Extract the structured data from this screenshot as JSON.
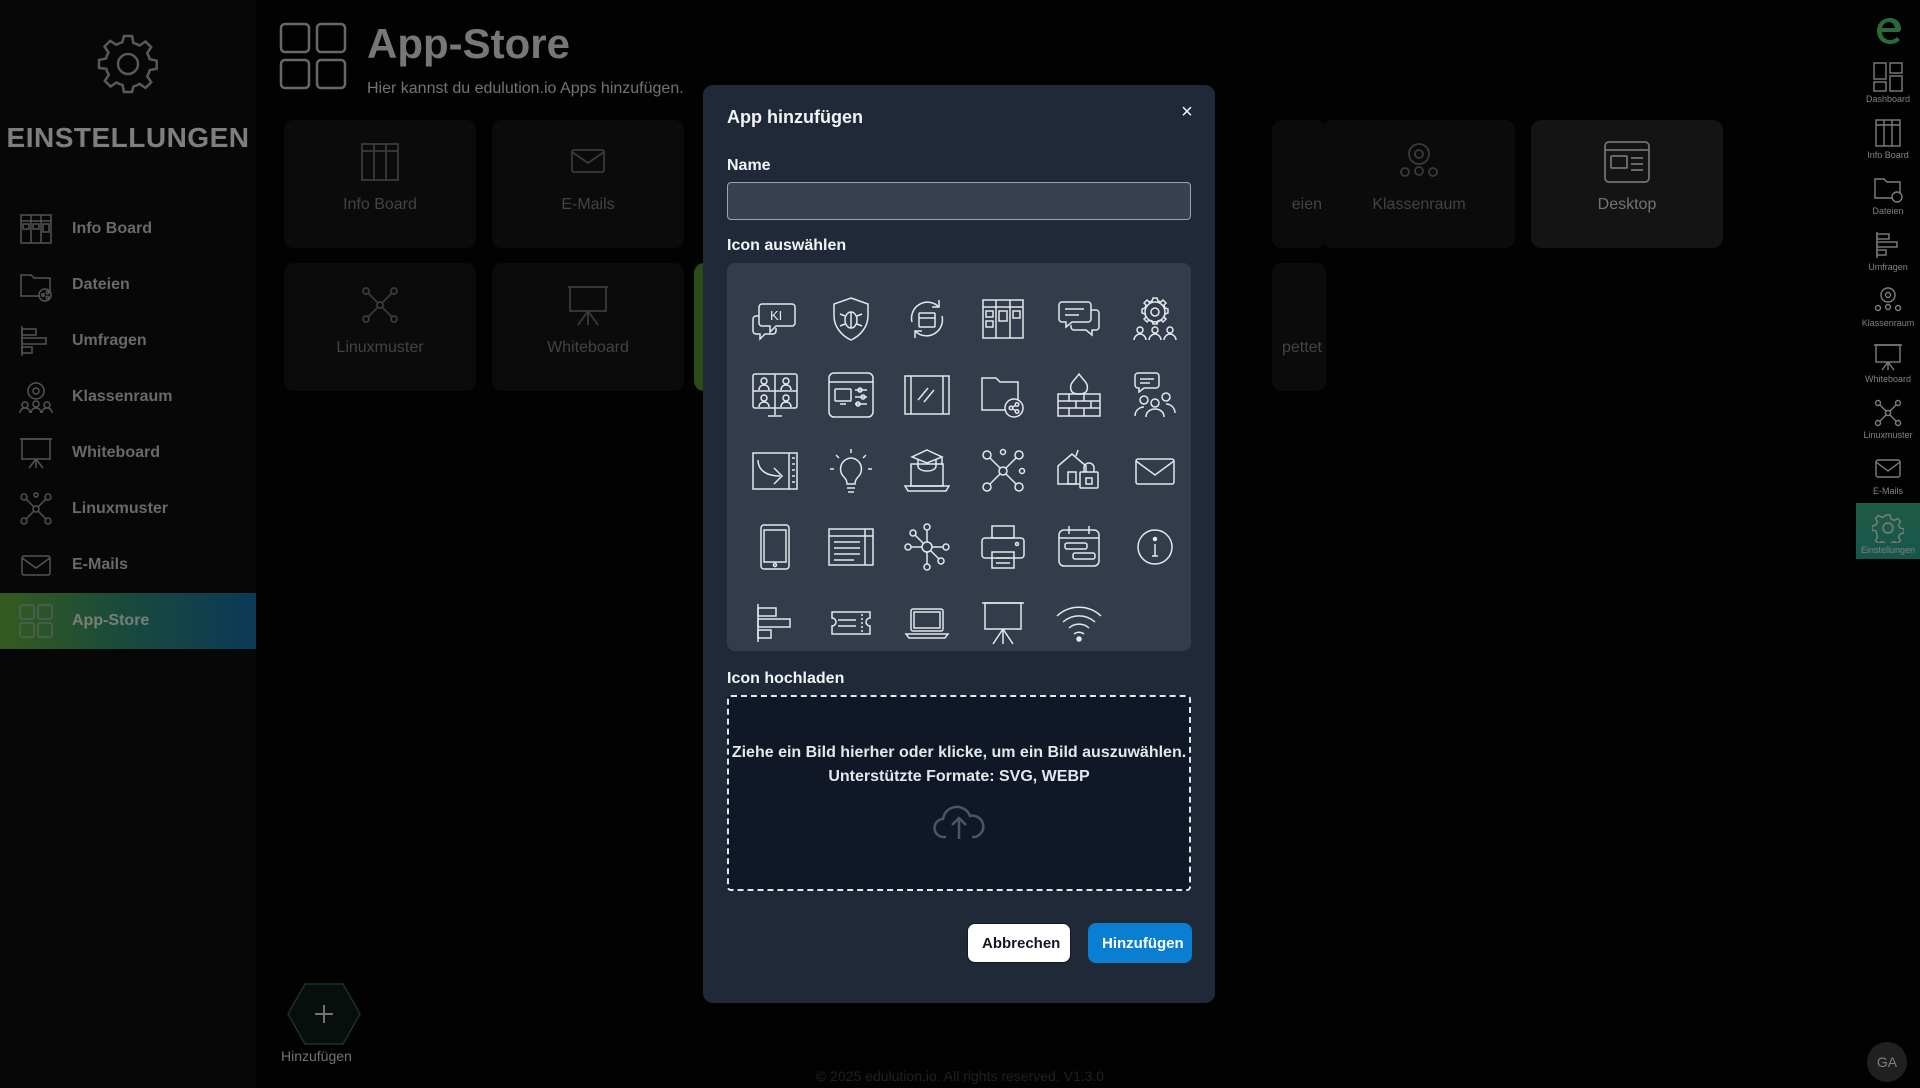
{
  "sidebar": {
    "title": "EINSTELLUNGEN",
    "items": [
      {
        "label": "Info Board",
        "icon": "info-board-icon"
      },
      {
        "label": "Dateien",
        "icon": "files-icon"
      },
      {
        "label": "Umfragen",
        "icon": "surveys-icon"
      },
      {
        "label": "Klassenraum",
        "icon": "classroom-icon"
      },
      {
        "label": "Whiteboard",
        "icon": "whiteboard-icon"
      },
      {
        "label": "Linuxmuster",
        "icon": "linuxmuster-icon"
      },
      {
        "label": "E-Mails",
        "icon": "mail-icon"
      },
      {
        "label": "App-Store",
        "icon": "app-store-icon",
        "active": true
      }
    ]
  },
  "page": {
    "title": "App-Store",
    "subtitle": "Hier kannst du edulution.io Apps hinzufügen.",
    "tiles": [
      {
        "label": "Info Board"
      },
      {
        "label": "E-Mails"
      },
      {
        "label": "eien"
      },
      {
        "label": "Klassenraum"
      },
      {
        "label": "Desktop"
      },
      {
        "label": "Linuxmuster"
      },
      {
        "label": "Whiteboard"
      },
      {
        "label": "pettet"
      }
    ],
    "add_label": "Hinzufügen",
    "footer": "© 2025 edulution.io. All rights reserved. V1.3.0"
  },
  "rightbar": {
    "items": [
      {
        "label": "Dashboard"
      },
      {
        "label": "Info Board"
      },
      {
        "label": "Dateien"
      },
      {
        "label": "Umfragen"
      },
      {
        "label": "Klassenraum"
      },
      {
        "label": "Whiteboard"
      },
      {
        "label": "Linuxmuster"
      },
      {
        "label": "E-Mails"
      },
      {
        "label": "Einstellungen",
        "active": true
      }
    ],
    "avatar": "GA"
  },
  "dialog": {
    "title": "App hinzufügen",
    "close": "×",
    "name_label": "Name",
    "name_value": "",
    "icon_select_label": "Icon auswählen",
    "icons": [
      "ai-chat-icon",
      "security-shield-icon",
      "sync-icon",
      "info-board-icon",
      "chat-icon",
      "admin-group-icon",
      "video-conference-icon",
      "desktop-settings-icon",
      "glass-panel-icon",
      "files-share-icon",
      "firewall-icon",
      "group-chat-icon",
      "forward-icon",
      "lightbulb-icon",
      "graduation-laptop-icon",
      "network-nodes-icon",
      "school-lock-icon",
      "mail-icon",
      "tablet-icon",
      "table-layout-icon",
      "hub-icon",
      "printer-icon",
      "calendar-icon",
      "info-circle-icon",
      "surveys-icon",
      "tickets-icon",
      "laptop-icon",
      "whiteboard-icon",
      "wifi-icon"
    ],
    "upload_label": "Icon hochladen",
    "upload_text_1": "Ziehe ein Bild hierher oder klicke, um ein Bild auszuwählen.",
    "upload_text_2": "Unterstützte Formate: SVG, WEBP",
    "cancel": "Abbrechen",
    "submit": "Hinzufügen"
  },
  "colors": {
    "accent_blue": "#0a7fd1",
    "active_gradient_start": "#63a53a",
    "active_gradient_end": "#15689e",
    "dialog_bg": "#1f2937"
  }
}
